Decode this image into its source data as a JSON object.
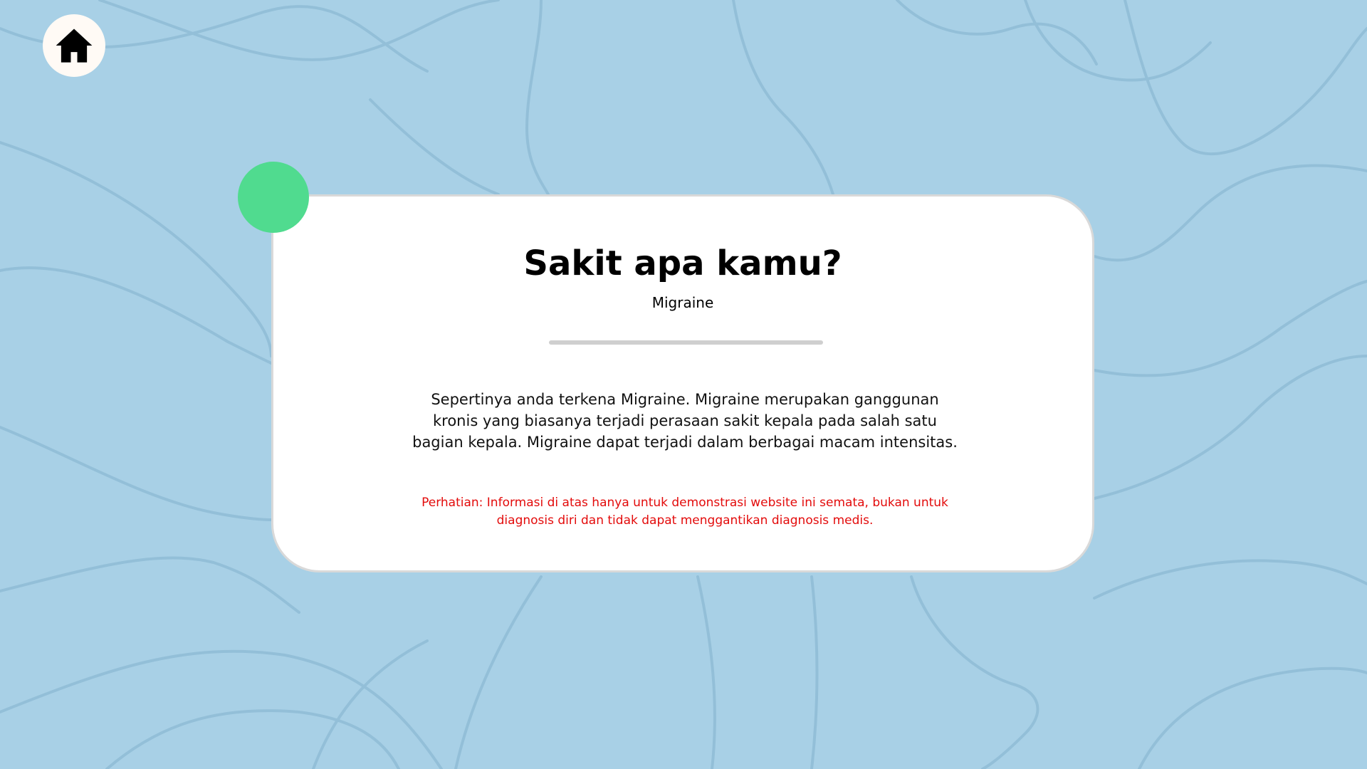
{
  "home": {
    "icon": "home-icon"
  },
  "card": {
    "title": "Sakit apa kamu?",
    "subtitle": "Migraine",
    "description": "Sepertinya anda terkena Migraine. Migraine merupakan ganggunan kronis yang biasanya terjadi perasaan sakit kepala pada salah satu bagian kepala. Migraine dapat terjadi dalam berbagai macam intensitas.",
    "warning": "Perhatian: Informasi di atas hanya untuk demonstrasi website ini semata, bukan untuk diagnosis diri dan tidak dapat menggantikan diagnosis medis."
  },
  "colors": {
    "background": "#a8d0e6",
    "accent": "#50db8f",
    "warning": "#e30b0b",
    "card": "#ffffff"
  }
}
